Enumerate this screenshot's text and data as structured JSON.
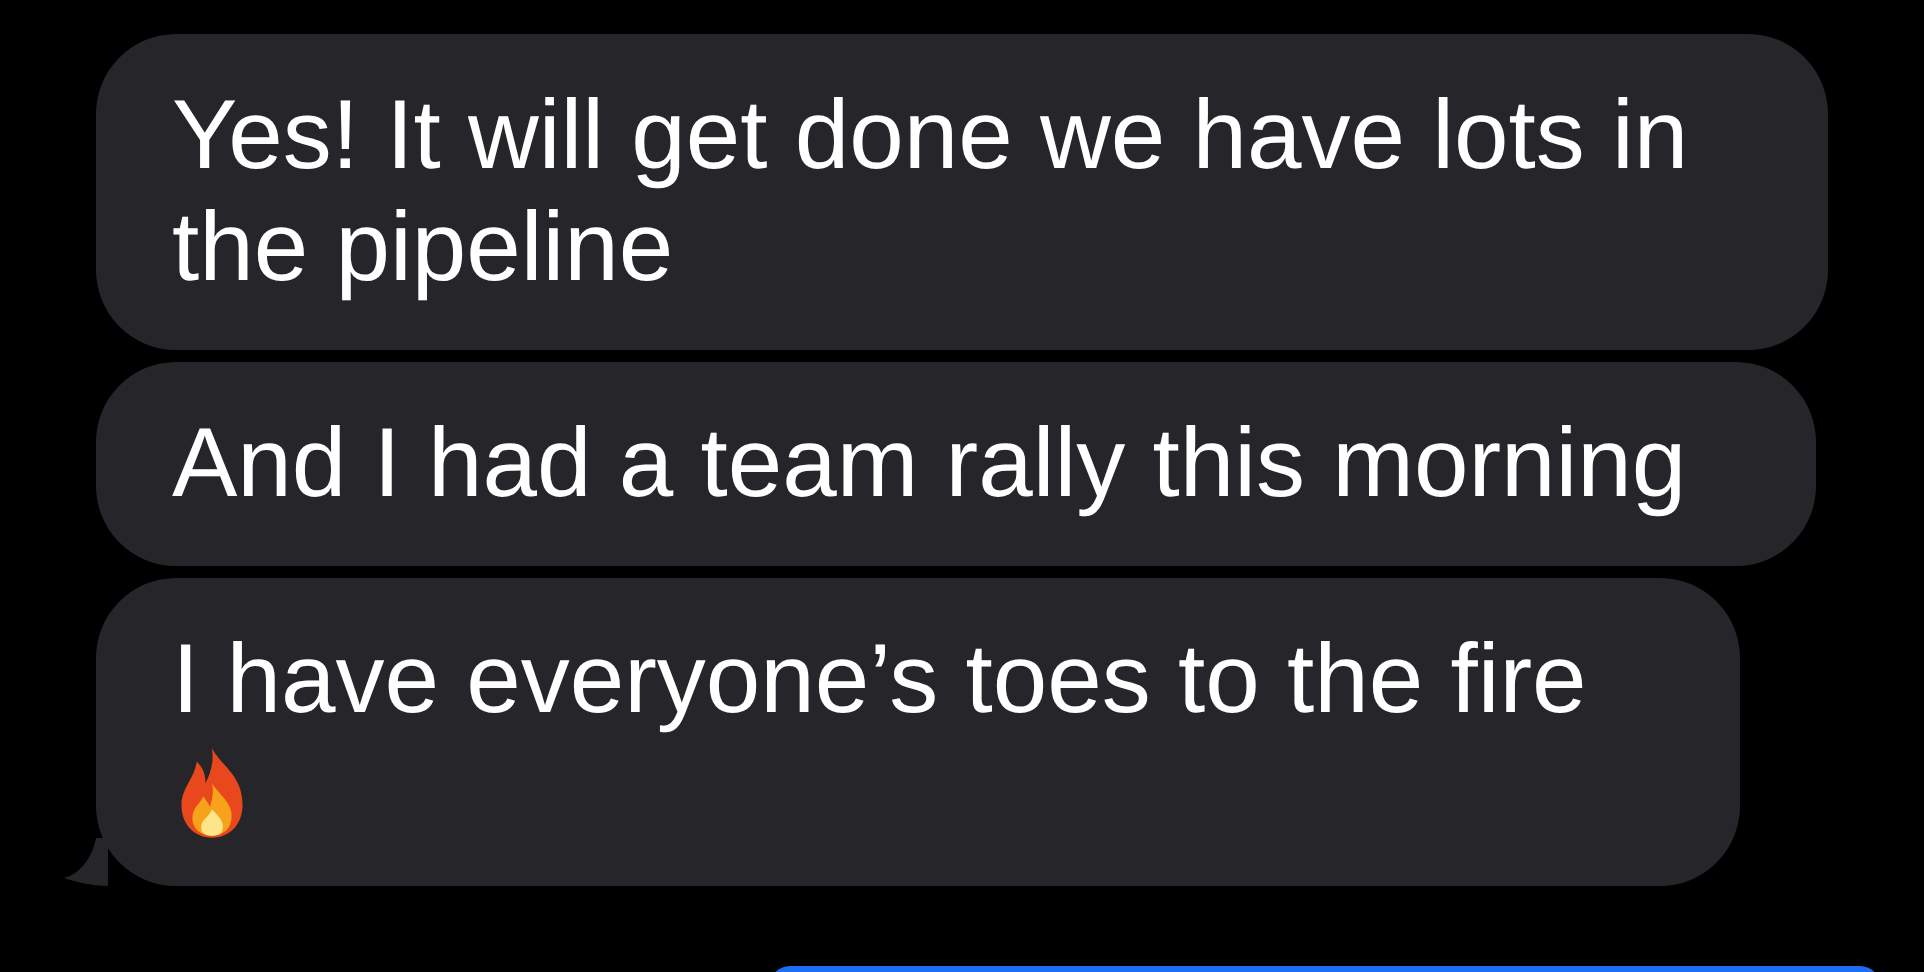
{
  "messages": [
    {
      "text": "Yes! It will get done we have lots in the pipeline",
      "tail": false,
      "fire": false
    },
    {
      "text": "And I had a team rally this morning",
      "tail": false,
      "fire": false
    },
    {
      "text": "I have everyone’s toes to the fire",
      "tail": true,
      "fire": true
    }
  ]
}
